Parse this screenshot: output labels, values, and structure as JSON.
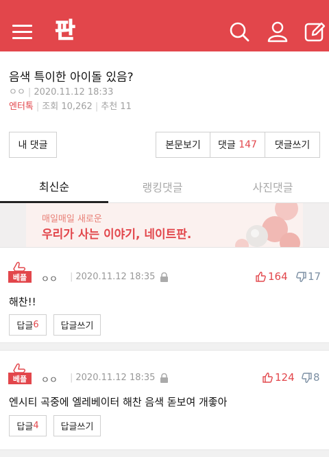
{
  "header": {
    "brand_color": "#e2464b",
    "logo_text": "판",
    "icons": [
      "menu-icon",
      "search-icon",
      "user-icon",
      "write-icon"
    ]
  },
  "post": {
    "title": "음색 특이한 아이돌 있음?",
    "author": "ㅇㅇ",
    "date": "2020.11.12 18:33",
    "category": "엔터톡",
    "views_label": "조회",
    "views": "10,262",
    "recommend_label": "추천",
    "recommend": "11"
  },
  "actions": {
    "my_comments": "내 댓글",
    "view_post": "본문보기",
    "comments_label": "댓글",
    "comments_count": "147",
    "write_comment": "댓글쓰기"
  },
  "tabs": [
    {
      "label": "최신순",
      "active": true
    },
    {
      "label": "랭킹댓글",
      "active": false
    },
    {
      "label": "사진댓글",
      "active": false
    }
  ],
  "ad": {
    "line1": "매일매일 새로운",
    "line2": "우리가 사는 이야기, 네이트판."
  },
  "comments": [
    {
      "badge": "베플",
      "author": "ㅇㅇ",
      "date": "2020.11.12 18:35",
      "likes": "164",
      "dislikes": "17",
      "text": "해찬!!",
      "reply_label": "답글",
      "reply_count": "6",
      "write_reply": "답글쓰기"
    },
    {
      "badge": "베플",
      "author": "ㅇㅇ",
      "date": "2020.11.12 18:35",
      "likes": "124",
      "dislikes": "8",
      "text": "엔시티 곡중에 엘레베이터 해찬 음색 돋보여 개좋아",
      "reply_label": "답글",
      "reply_count": "4",
      "write_reply": "답글쓰기"
    }
  ]
}
